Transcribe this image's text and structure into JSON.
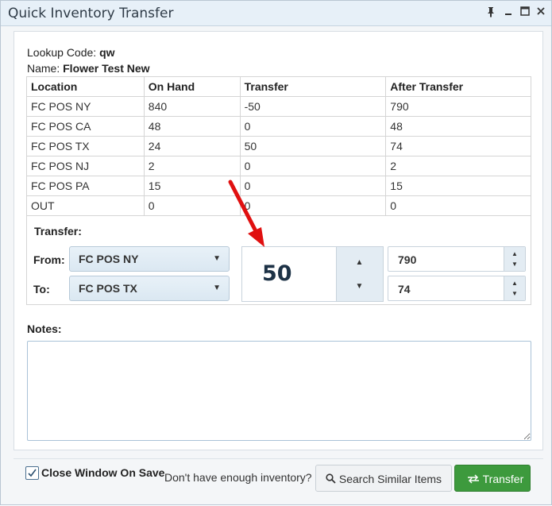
{
  "window": {
    "title": "Quick Inventory Transfer"
  },
  "item": {
    "lookup_label": "Lookup Code:",
    "lookup_value": "qw",
    "name_label": "Name:",
    "name_value": "Flower Test New"
  },
  "table": {
    "headers": [
      "Location",
      "On Hand",
      "Transfer",
      "After Transfer"
    ],
    "rows": [
      [
        "FC POS NY",
        "840",
        "-50",
        "790"
      ],
      [
        "FC POS CA",
        "48",
        "0",
        "48"
      ],
      [
        "FC POS TX",
        "24",
        "50",
        "74"
      ],
      [
        "FC POS NJ",
        "2",
        "0",
        "2"
      ],
      [
        "FC POS PA",
        "15",
        "0",
        "15"
      ],
      [
        "OUT",
        "0",
        "0",
        "0"
      ]
    ]
  },
  "transfer": {
    "section_label": "Transfer:",
    "from_label": "From:",
    "from_value": "FC POS NY",
    "to_label": "To:",
    "to_value": "FC POS TX",
    "quantity": "50",
    "from_after": "790",
    "to_after": "74"
  },
  "notes": {
    "label": "Notes:",
    "value": ""
  },
  "footer": {
    "close_on_save_label": "Close Window On Save",
    "close_on_save_checked": true,
    "hint": "Don't have enough inventory?",
    "search_button": "Search Similar Items",
    "transfer_button": "Transfer"
  },
  "colors": {
    "accent": "#3d9a3d",
    "arrow": "#e01010"
  }
}
